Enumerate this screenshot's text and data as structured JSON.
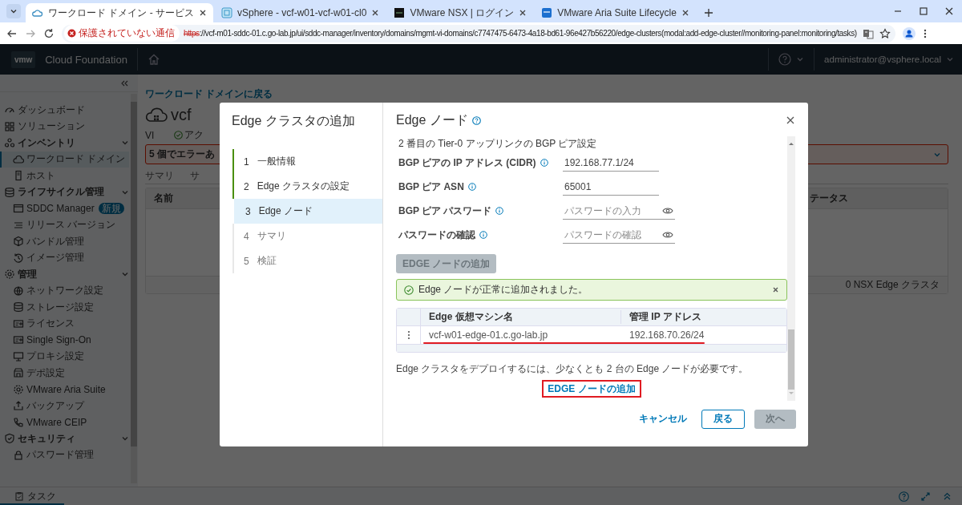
{
  "browser": {
    "tabs": [
      {
        "title": "ワークロード ドメイン - サービス",
        "selected": true
      },
      {
        "title": "vSphere - vcf-w01-vcf-w01-cl0",
        "selected": false
      },
      {
        "title": "VMware NSX | ログイン",
        "selected": false
      },
      {
        "title": "VMware Aria Suite Lifecycle",
        "selected": false
      }
    ],
    "security_chip": "保護されていない通信",
    "url_scheme": "https",
    "url_rest": "://vcf-m01-sddc-01.c.go-lab.jp/ui/sddc-manager/inventory/domains/mgmt-vi-domains/c7747475-6473-4a18-bd61-96e427b56220/edge-clusters(modal:add-edge-cluster//monitoring-panel:monitoring/tasks)"
  },
  "app_header": {
    "logo": "vmw",
    "product": "Cloud Foundation",
    "user": "administrator@vsphere.local"
  },
  "sidebar": {
    "items": [
      {
        "label": "ダッシュボード",
        "kind": "link",
        "selected": false
      },
      {
        "label": "ソリューション",
        "kind": "link",
        "selected": false
      },
      {
        "label": "インベントリ",
        "kind": "section",
        "expanded": true,
        "children": [
          {
            "label": "ワークロード ドメイン",
            "selected": true
          },
          {
            "label": "ホスト",
            "selected": false
          }
        ]
      },
      {
        "label": "ライフサイクル管理",
        "kind": "section",
        "expanded": true,
        "children": [
          {
            "label": "SDDC Manager",
            "badge": "新規",
            "selected": false
          },
          {
            "label": "リリース バージョン",
            "selected": false
          },
          {
            "label": "バンドル管理",
            "selected": false
          },
          {
            "label": "イメージ管理",
            "selected": false
          }
        ]
      },
      {
        "label": "管理",
        "kind": "section",
        "expanded": true,
        "children": [
          {
            "label": "ネットワーク設定",
            "selected": false
          },
          {
            "label": "ストレージ設定",
            "selected": false
          },
          {
            "label": "ライセンス",
            "selected": false
          },
          {
            "label": "Single Sign-On",
            "selected": false
          },
          {
            "label": "プロキシ設定",
            "selected": false
          },
          {
            "label": "デポ設定",
            "selected": false
          },
          {
            "label": "VMware Aria Suite",
            "selected": false
          },
          {
            "label": "バックアップ",
            "selected": false
          },
          {
            "label": "VMware CEIP",
            "selected": false
          }
        ]
      },
      {
        "label": "セキュリティ",
        "kind": "section",
        "expanded": true,
        "children": [
          {
            "label": "パスワード管理",
            "selected": false
          }
        ]
      }
    ]
  },
  "page": {
    "back_link": "ワークロード ドメインに戻る",
    "title": "vcf",
    "domain_type": "VI",
    "status": "アク",
    "error_banner": "5 個でエラーあ",
    "tabs": [
      "サマリ",
      "サ"
    ],
    "table": {
      "columns": [
        "名前",
        "テータス"
      ],
      "footer": "0 NSX Edge クラスタ"
    }
  },
  "modal": {
    "title": "Edge クラスタの追加",
    "steps": [
      {
        "number": "1",
        "label": "一般情報",
        "completed": true,
        "selected": false
      },
      {
        "number": "2",
        "label": "Edge クラスタの設定",
        "completed": true,
        "selected": false
      },
      {
        "number": "3",
        "label": "Edge ノード",
        "completed": false,
        "selected": true
      },
      {
        "number": "4",
        "label": "サマリ",
        "completed": false,
        "selected": false
      },
      {
        "number": "5",
        "label": "検証",
        "completed": false,
        "selected": false
      }
    ],
    "heading": "Edge ノード",
    "section_title": "2 番目の Tier-0 アップリンクの BGP ピア設定",
    "fields": [
      {
        "label": "BGP ピアの IP アドレス (CIDR)",
        "kind": "text",
        "value": "192.168.77.1/24"
      },
      {
        "label": "BGP ピア ASN",
        "kind": "text",
        "value": "65001"
      },
      {
        "label": "BGP ピア パスワード",
        "kind": "password",
        "placeholder": "パスワードの入力"
      },
      {
        "label": "パスワードの確認",
        "kind": "password",
        "placeholder": "パスワードの確認"
      }
    ],
    "add_button": {
      "label": "EDGE ノードの追加",
      "disabled": true
    },
    "alert": {
      "kind": "success",
      "message": "Edge ノードが正常に追加されました。"
    },
    "nodes_table": {
      "columns": [
        "Edge 仮想マシン名",
        "管理 IP アドレス"
      ],
      "rows": [
        {
          "cells": [
            "vcf-w01-edge-01.c.go-lab.jp",
            "192.168.70.26/24"
          ],
          "highlighted": true
        }
      ]
    },
    "note": "Edge クラスタをデプロイするには、少なくとも 2 台の Edge ノードが必要です。",
    "add_link": {
      "label": "EDGE ノードの追加",
      "highlighted": true
    },
    "footer_buttons": [
      {
        "label": "キャンセル",
        "kind": "link",
        "disabled": false
      },
      {
        "label": "戻る",
        "kind": "outline",
        "disabled": false
      },
      {
        "label": "次へ",
        "kind": "primary",
        "disabled": true
      }
    ]
  },
  "task_bar": {
    "label": "タスク"
  }
}
